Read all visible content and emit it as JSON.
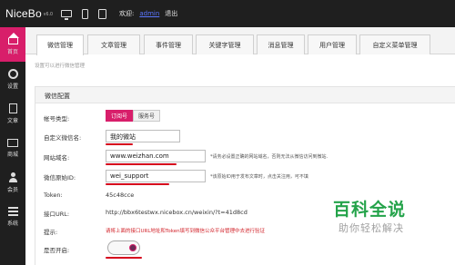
{
  "app": {
    "logo": "NiceBo",
    "version": "v6.0"
  },
  "topbar": {
    "welcome": "欢迎:",
    "username": "admin",
    "logout": "退出"
  },
  "sidebar": {
    "items": [
      {
        "label": "首页",
        "icon": "home-icon"
      },
      {
        "label": "设置",
        "icon": "gear-icon"
      },
      {
        "label": "文章",
        "icon": "document-icon"
      },
      {
        "label": "商城",
        "icon": "mail-icon"
      },
      {
        "label": "会员",
        "icon": "user-icon"
      },
      {
        "label": "系统",
        "icon": "grid-icon"
      }
    ]
  },
  "tabs": [
    "微信管理",
    "文章管理",
    "事件管理",
    "关键字管理",
    "消息管理",
    "用户管理",
    "自定义菜单管理"
  ],
  "breadcrumb": "设置可以进行微信管理",
  "panel": {
    "title": "微信配置",
    "account_type_label": "帐号类型:",
    "account_type_options": [
      "订阅号",
      "服务号"
    ],
    "custom_name_label": "自定义微信名:",
    "custom_name_value": "我的微站",
    "site_domain_label": "网站域名:",
    "site_domain_value": "www.weizhan.com",
    "site_domain_hint": "*请务必设置正确的网站域名，否则无法从微信访问到微站.",
    "original_id_label": "微信原始ID:",
    "original_id_value": "wei_support",
    "original_id_hint": "*该原始ID用于发布文章时，点击关注用，可不填",
    "token_label": "Token:",
    "token_value": "45c48cce",
    "interface_label": "接口URL:",
    "interface_value": "http://bbx6testwx.nicebox.cn/weixin/?t=41d8cd",
    "tip_label": "提示:",
    "tip_value": "请将上面的接口URL地址和Token填写到微信公众平台管理中去进行验证",
    "enabled_label": "是否开启:"
  },
  "watermark": {
    "title": "百科全说",
    "subtitle": "助你轻松解决"
  },
  "colors": {
    "accent": "#d81e6a",
    "annotation": "#d6001c",
    "topbar": "#1f1f1f",
    "warning": "#d2232a"
  }
}
